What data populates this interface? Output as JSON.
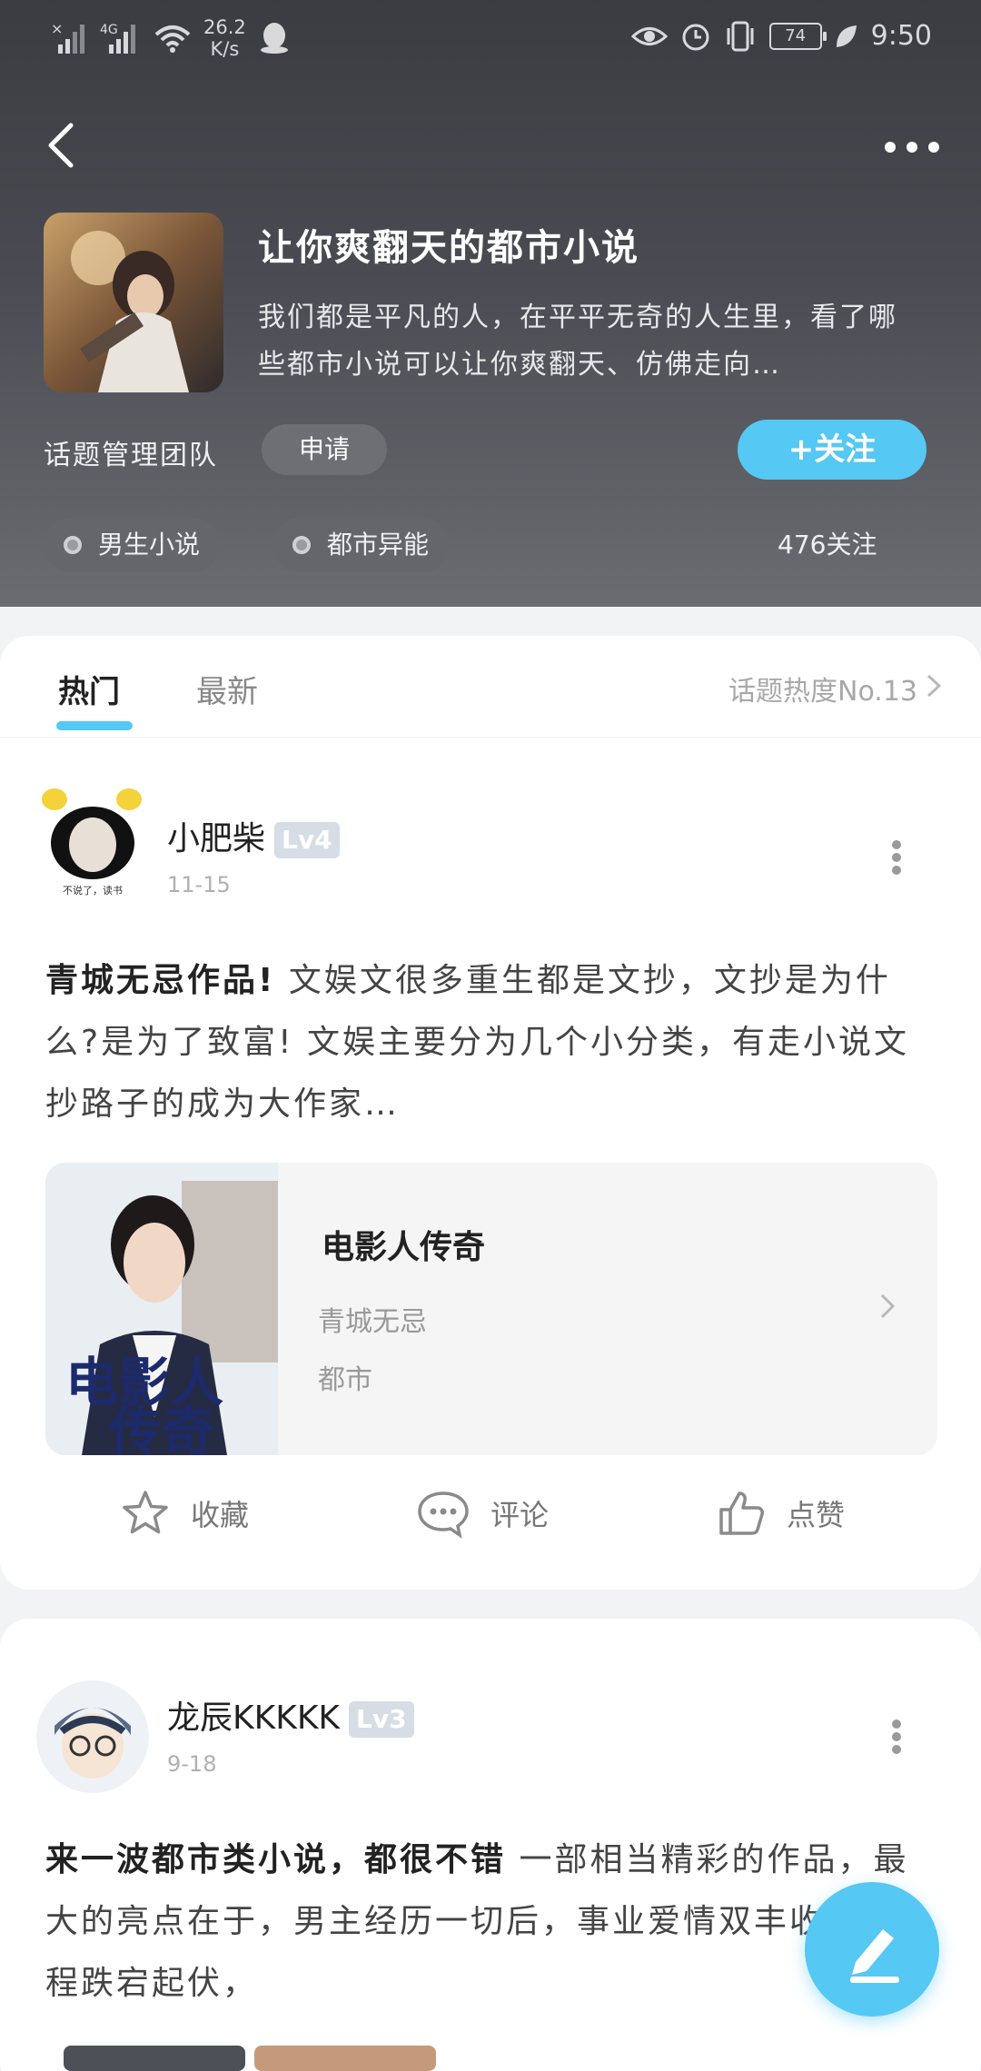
{
  "status_bar": {
    "network": "4G",
    "speed_value": "26.2",
    "speed_unit": "K/s",
    "battery": "74",
    "time": "9:50"
  },
  "topic": {
    "title": "让你爽翻天的都市小说",
    "description": "我们都是平凡的人，在平平无奇的人生里，看了哪些都市小说可以让你爽翻天、仿佛走向…",
    "team_label": "话题管理团队",
    "apply_label": "申请",
    "follow_label": "+关注",
    "tags": [
      "男生小说",
      "都市异能"
    ],
    "follow_count": "476关注"
  },
  "tabs": {
    "hot": "热门",
    "latest": "最新",
    "rank": "话题热度No.13"
  },
  "posts": [
    {
      "username": "小肥柴",
      "level": "Lv4",
      "date": "11-15",
      "bold_text": "青城无忌作品!",
      "text": "  文娱文很多重生都是文抄，文抄是为什么?是为了致富! 文娱主要分为几个小分类，有走小说文抄路子的成为大作家…",
      "book": {
        "title": "电影人传奇",
        "author": "青城无忌",
        "genre": "都市"
      },
      "actions": {
        "collect": "收藏",
        "comment": "评论",
        "like": "点赞"
      }
    },
    {
      "username": "龙辰KKKKK",
      "level": "Lv3",
      "date": "9-18",
      "bold_text": "来一波都市类小说，都很不错",
      "text": " 一部相当精彩的作品，最大的亮点在于，男主经历一切后，事业爱情双丰收，其过程跌宕起伏，"
    }
  ],
  "colors": {
    "accent": "#55c8f3",
    "header_bg": "#45464c"
  }
}
